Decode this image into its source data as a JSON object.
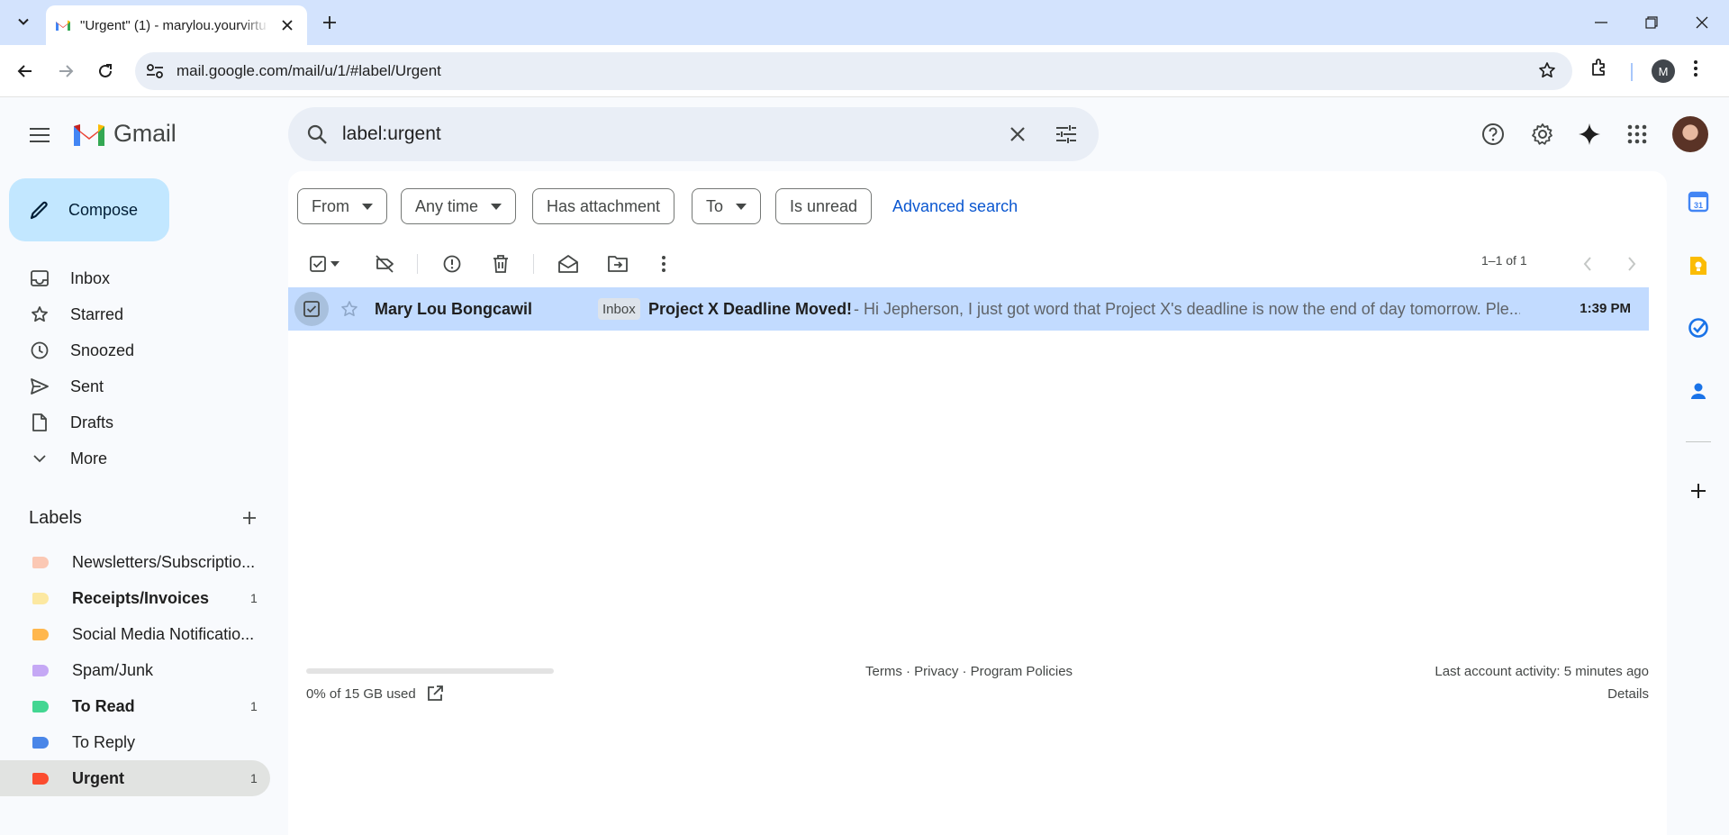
{
  "browser": {
    "tab_title": "\"Urgent\" (1) - marylou.yourvirtu",
    "url": "mail.google.com/mail/u/1/#label/Urgent",
    "profile_initial": "M"
  },
  "gmail": {
    "logo_text": "Gmail",
    "search_query": "label:urgent",
    "compose_label": "Compose",
    "nav": [
      {
        "label": "Inbox",
        "icon": "inbox-icon"
      },
      {
        "label": "Starred",
        "icon": "star-icon"
      },
      {
        "label": "Snoozed",
        "icon": "clock-icon"
      },
      {
        "label": "Sent",
        "icon": "send-icon"
      },
      {
        "label": "Drafts",
        "icon": "draft-icon"
      },
      {
        "label": "More",
        "icon": "chevron-down-icon"
      }
    ],
    "labels_title": "Labels",
    "labels": [
      {
        "name": "Newsletters/Subscriptio...",
        "color": "#fbc8b4",
        "count": "",
        "bold": false
      },
      {
        "name": "Receipts/Invoices",
        "color": "#fce8a1",
        "count": "1",
        "bold": true
      },
      {
        "name": "Social Media Notificatio...",
        "color": "#ffb74d",
        "count": "",
        "bold": false
      },
      {
        "name": "Spam/Junk",
        "color": "#c5a8f5",
        "count": "",
        "bold": false
      },
      {
        "name": "To Read",
        "color": "#43d692",
        "count": "1",
        "bold": true
      },
      {
        "name": "To Reply",
        "color": "#4a86e8",
        "count": "",
        "bold": false
      },
      {
        "name": "Urgent",
        "color": "#fb4c2f",
        "count": "1",
        "bold": true
      }
    ],
    "filters": {
      "from": "From",
      "any_time": "Any time",
      "has_attachment": "Has attachment",
      "to": "To",
      "is_unread": "Is unread",
      "advanced": "Advanced search"
    },
    "pager": "1–1 of 1",
    "email": {
      "sender": "Mary Lou Bongcawil",
      "badge": "Inbox",
      "subject": "Project X Deadline Moved!",
      "snippet": " - Hi Jepherson, I just got word that Project X's deadline is now the end of day tomorrow. Ple...",
      "time": "1:39 PM"
    },
    "footer": {
      "storage_used": 0,
      "storage": "0% of 15 GB used",
      "links": "Terms · Privacy · Program Policies",
      "activity": "Last account activity: 5 minutes ago",
      "details": "Details"
    }
  },
  "colors": {
    "accent": "#0b57d0",
    "selected_row": "#c2dbff",
    "compose": "#c2e7ff"
  }
}
